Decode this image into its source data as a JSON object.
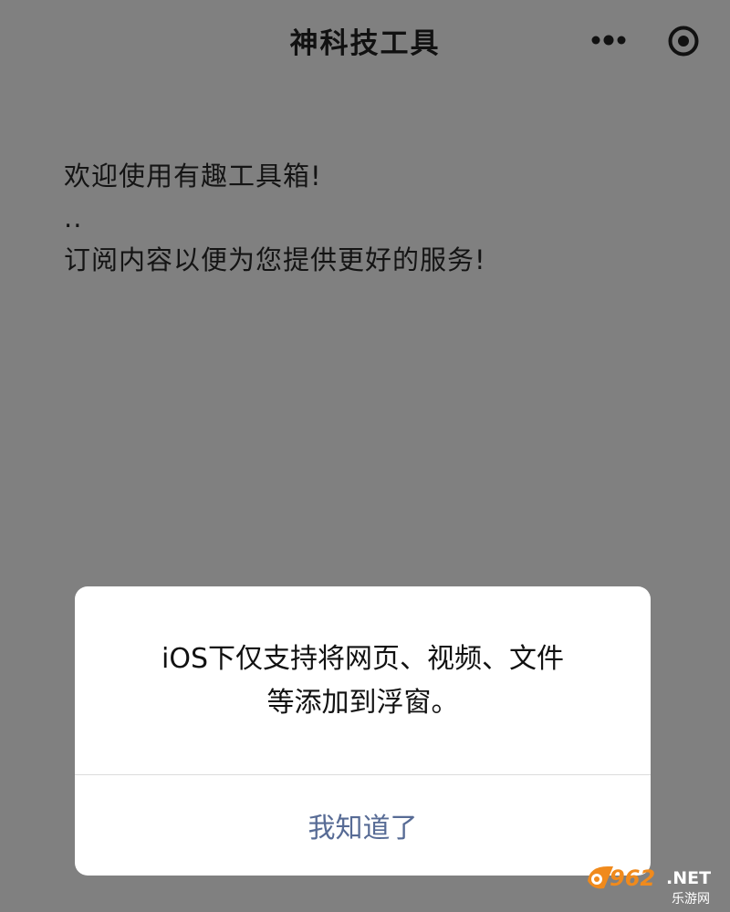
{
  "nav": {
    "title": "神科技工具",
    "more_icon": "more-dots-icon",
    "close_icon": "target-circle-icon"
  },
  "content": {
    "lines": [
      "欢迎使用有趣工具箱!",
      "..",
      "订阅内容以便为您提供更好的服务!"
    ]
  },
  "dialog": {
    "message_lines": [
      "iOS下仅支持将网页、视频、文件",
      "等添加到浮窗。"
    ],
    "confirm_label": "我知道了"
  },
  "watermark": {
    "number": "962",
    "suffix": ".NET",
    "subtitle": "乐游网"
  },
  "colors": {
    "overlay_background": "#808080",
    "dialog_button_text": "#576b95",
    "watermark_orange": "#f08a1c"
  }
}
